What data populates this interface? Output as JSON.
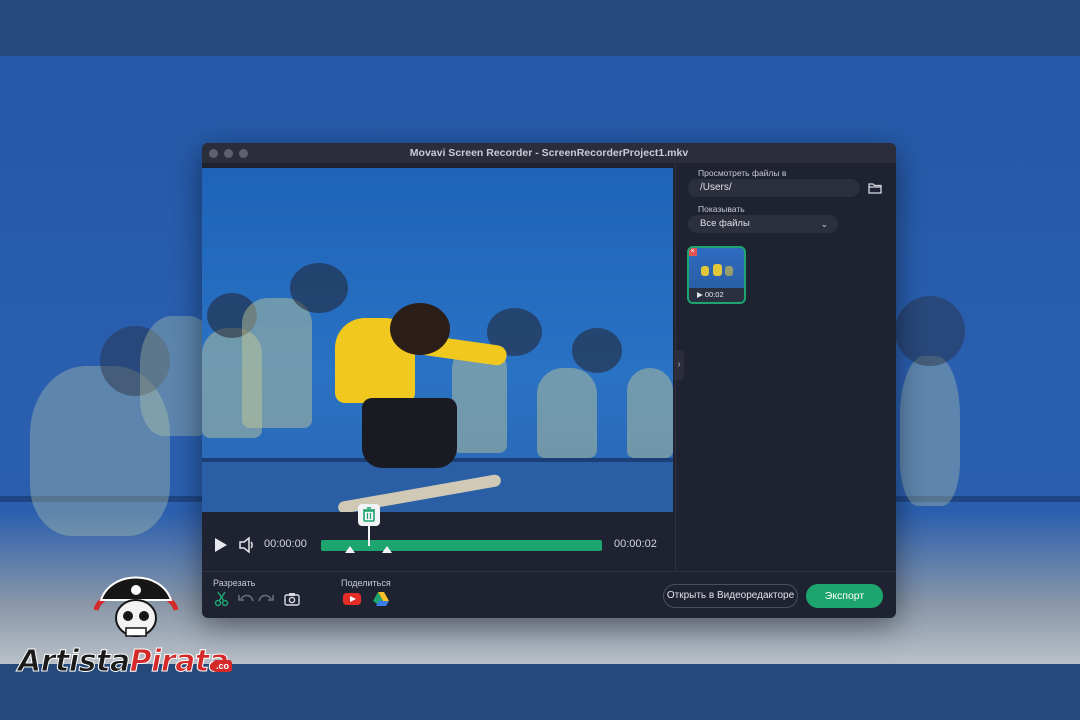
{
  "window": {
    "title": "Movavi Screen Recorder - ScreenRecorderProject1.mkv"
  },
  "player": {
    "current_time": "00:00:00",
    "total_time": "00:00:02"
  },
  "toolbar": {
    "cut_label": "Разрезать",
    "share_label": "Поделиться",
    "open_editor_label": "Открыть в Видеоредакторе",
    "export_label": "Экспорт"
  },
  "panel": {
    "browse_label": "Просмотреть файлы в",
    "path_value": "/Users/",
    "show_label": "Показывать",
    "filter_value": "Все файлы",
    "thumbnail": {
      "duration": "00:02"
    }
  },
  "watermark": {
    "brand_part1": "Artista",
    "brand_part2": "Pirata",
    "brand_tld": ".co"
  },
  "colors": {
    "accent": "#1ea56f",
    "youtube": "#e52d27",
    "window_bg": "#1f2230",
    "background": "#2558a6"
  }
}
